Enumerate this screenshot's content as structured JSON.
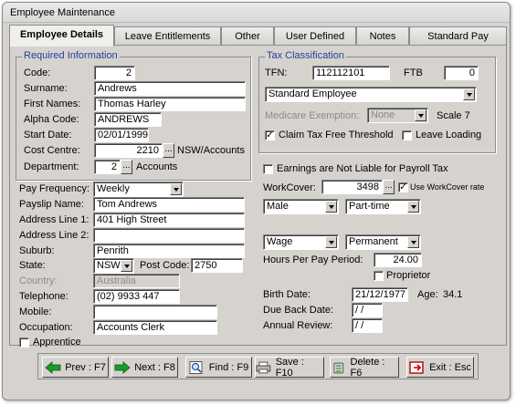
{
  "window": {
    "title": "Employee Maintenance"
  },
  "tabs": [
    "Employee Details",
    "Leave Entitlements",
    "Other",
    "User Defined",
    "Notes",
    "Standard Pay"
  ],
  "required": {
    "legend": "Required Information",
    "code_label": "Code:",
    "code": "2",
    "surname_label": "Surname:",
    "surname": "Andrews",
    "first_label": "First Names:",
    "first": "Thomas  Harley",
    "alpha_label": "Alpha Code:",
    "alpha": "ANDREWS",
    "start_label": "Start Date:",
    "start": "02/01/1999",
    "cost_label": "Cost Centre:",
    "cost": "2210",
    "cost_text": "NSW/Accounts",
    "dept_label": "Department:",
    "dept": "2",
    "dept_text": "Accounts"
  },
  "personal": {
    "payfreq_label": "Pay Frequency:",
    "payfreq": "Weekly",
    "payslip_label": "Payslip Name:",
    "payslip": "Tom  Andrews",
    "addr1_label": "Address Line 1:",
    "addr1": "401 High Street",
    "addr2_label": "Address Line 2:",
    "addr2": "",
    "suburb_label": "Suburb:",
    "suburb": "Penrith",
    "state_label": "State:",
    "state": "NSW",
    "postcode_label": "Post Code:",
    "postcode": "2750",
    "country_label": "Country:",
    "country": "Australia",
    "tel_label": "Telephone:",
    "tel": "(02) 9933 447",
    "mobile_label": "Mobile:",
    "mobile": "",
    "occ_label": "Occupation:",
    "occ": "Accounts Clerk",
    "apprentice_label": "Apprentice"
  },
  "tax": {
    "legend": "Tax Classification",
    "tfn_label": "TFN:",
    "tfn": "112112101",
    "ftb_label": "FTB",
    "ftb": "0",
    "type": "Standard Employee",
    "medicare_label": "Medicare Exemption:",
    "medicare": "None",
    "scale": "Scale 7",
    "claim_label": "Claim Tax Free Threshold",
    "leave_label": "Leave Loading"
  },
  "other": {
    "liable_label": "Earnings are Not Liable for Payroll Tax",
    "workcover_label": "WorkCover:",
    "workcover": "3498",
    "use_wc_label": "Use WorkCover rate",
    "gender": "Male",
    "employment": "Part-time",
    "paytype": "Wage",
    "status": "Permanent",
    "hours_label": "Hours Per Pay Period:",
    "hours": "24.00",
    "proprietor_label": "Proprietor",
    "birth_label": "Birth Date:",
    "birth": "21/12/1977",
    "age_label": "Age:",
    "age": "34.1",
    "dueback_label": "Due Back Date:",
    "dueback": " /  /",
    "annual_label": "Annual Review:",
    "annual": " /  /"
  },
  "buttons": {
    "prev": "Prev : F7",
    "next": "Next : F8",
    "find": "Find : F9",
    "save": "Save : F10",
    "delete": "Delete : F6",
    "exit": "Exit : Esc"
  }
}
